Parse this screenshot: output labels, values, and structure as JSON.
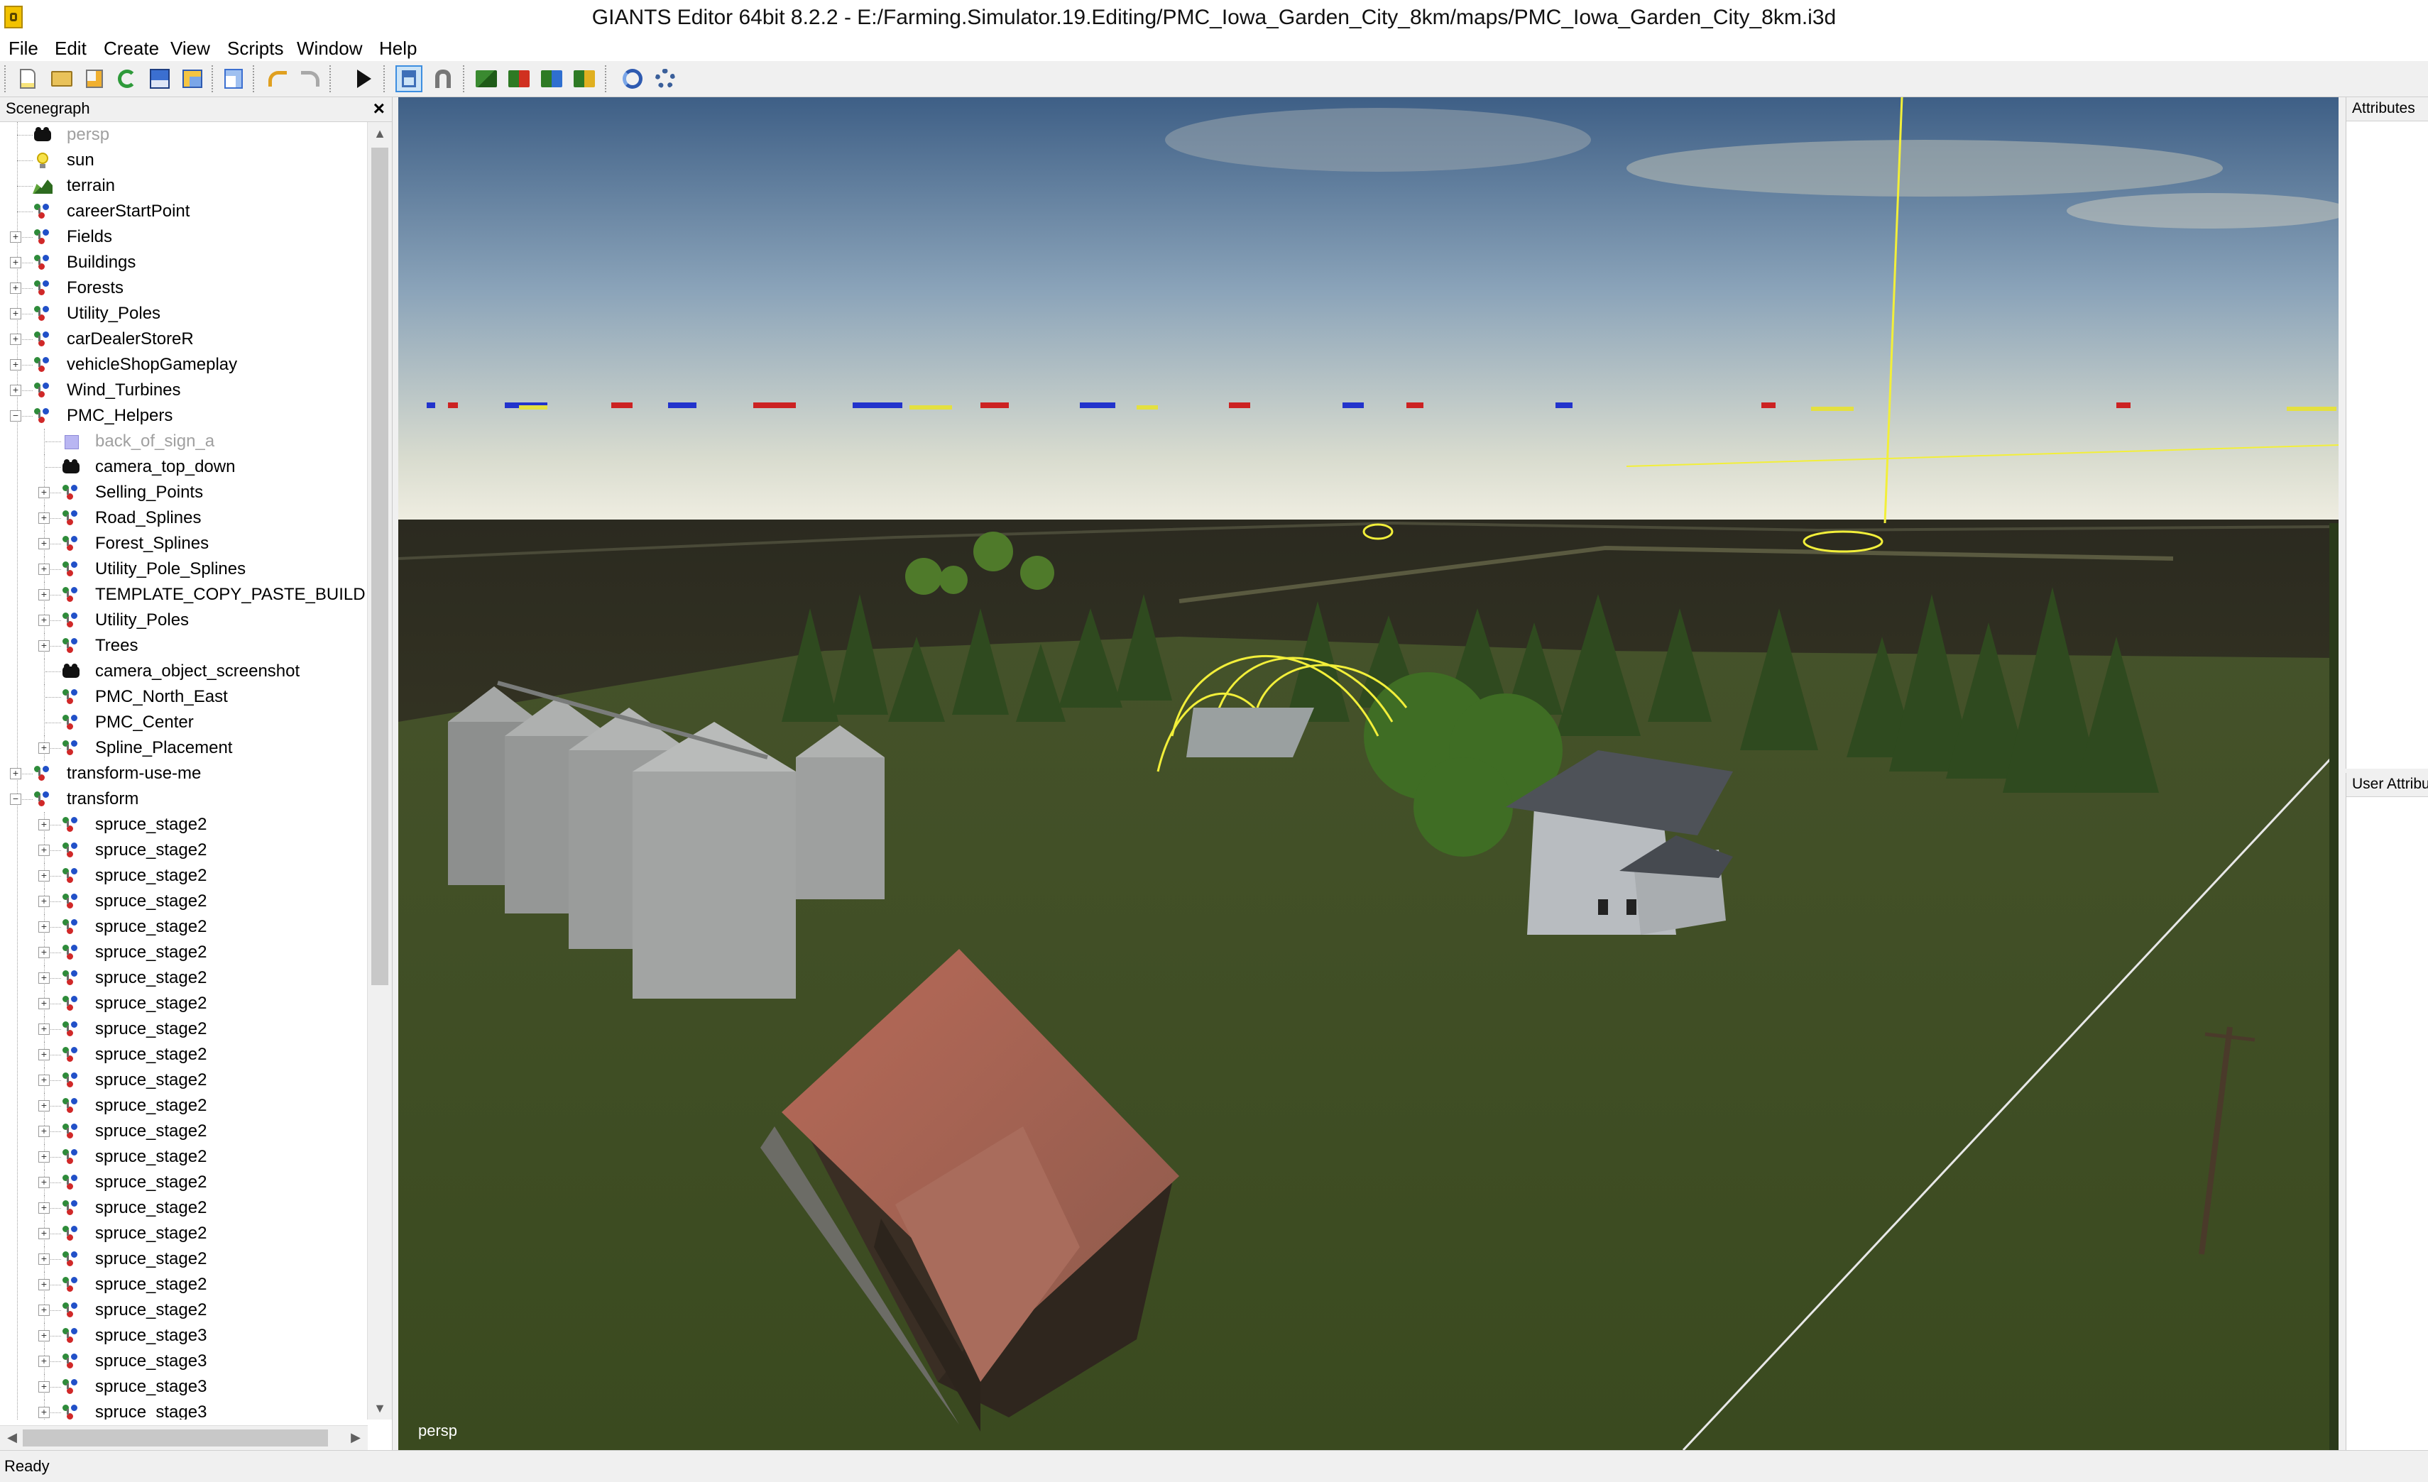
{
  "window": {
    "title": "GIANTS Editor 64bit 8.2.2 - E:/Farming.Simulator.19.Editing/PMC_Iowa_Garden_City_8km/maps/PMC_Iowa_Garden_City_8km.i3d"
  },
  "menu": {
    "items": [
      {
        "label": "File"
      },
      {
        "label": "Edit"
      },
      {
        "label": "Create"
      },
      {
        "label": "View"
      },
      {
        "label": "Scripts"
      },
      {
        "label": "Window"
      },
      {
        "label": "Help"
      }
    ]
  },
  "toolbar": {
    "buttons": [
      {
        "icon": "new-file-icon"
      },
      {
        "icon": "open-folder-icon"
      },
      {
        "icon": "edit-file-icon"
      },
      {
        "icon": "reload-icon"
      },
      {
        "icon": "save-icon"
      },
      {
        "icon": "export-icon"
      },
      {
        "icon": "import-icon"
      },
      {
        "icon": "undo-icon"
      },
      {
        "icon": "redo-icon"
      },
      {
        "icon": "play-icon"
      },
      {
        "icon": "select-mode-icon",
        "pressed": true
      },
      {
        "icon": "magnet-icon"
      },
      {
        "icon": "terrain-sculpt-icon"
      },
      {
        "icon": "terrain-paint-icon"
      },
      {
        "icon": "foliage-paint-icon"
      },
      {
        "icon": "object-placement-icon"
      },
      {
        "icon": "refresh-scene-icon"
      },
      {
        "icon": "settings-icon"
      }
    ]
  },
  "scenegraph": {
    "title": "Scenegraph",
    "close": "×",
    "items": [
      {
        "label": "persp",
        "icon": "camera-icon",
        "level": 0,
        "expander": "",
        "dim": true
      },
      {
        "label": "sun",
        "icon": "light-icon",
        "level": 0,
        "expander": ""
      },
      {
        "label": "terrain",
        "icon": "terrain-icon",
        "level": 0,
        "expander": ""
      },
      {
        "label": "careerStartPoint",
        "icon": "transform-group-icon",
        "level": 0,
        "expander": ""
      },
      {
        "label": "Fields",
        "icon": "transform-group-icon",
        "level": 0,
        "expander": "+"
      },
      {
        "label": "Buildings",
        "icon": "transform-group-icon",
        "level": 0,
        "expander": "+"
      },
      {
        "label": "Forests",
        "icon": "transform-group-icon",
        "level": 0,
        "expander": "+"
      },
      {
        "label": "Utility_Poles",
        "icon": "transform-group-icon",
        "level": 0,
        "expander": "+"
      },
      {
        "label": "carDealerStoreR",
        "icon": "transform-group-icon",
        "level": 0,
        "expander": "+"
      },
      {
        "label": "vehicleShopGameplay",
        "icon": "transform-group-icon",
        "level": 0,
        "expander": "+"
      },
      {
        "label": "Wind_Turbines",
        "icon": "transform-group-icon",
        "level": 0,
        "expander": "+"
      },
      {
        "label": "PMC_Helpers",
        "icon": "transform-group-icon",
        "level": 0,
        "expander": "−"
      },
      {
        "label": "back_of_sign_a",
        "icon": "shape-icon",
        "level": 1,
        "expander": "",
        "dim": true
      },
      {
        "label": "camera_top_down",
        "icon": "camera-icon",
        "level": 1,
        "expander": ""
      },
      {
        "label": "Selling_Points",
        "icon": "transform-group-icon",
        "level": 1,
        "expander": "+"
      },
      {
        "label": "Road_Splines",
        "icon": "transform-group-icon",
        "level": 1,
        "expander": "+"
      },
      {
        "label": "Forest_Splines",
        "icon": "transform-group-icon",
        "level": 1,
        "expander": "+"
      },
      {
        "label": "Utility_Pole_Splines",
        "icon": "transform-group-icon",
        "level": 1,
        "expander": "+"
      },
      {
        "label": "TEMPLATE_COPY_PASTE_BUILD",
        "icon": "transform-group-icon",
        "level": 1,
        "expander": "+"
      },
      {
        "label": "Utility_Poles",
        "icon": "transform-group-icon",
        "level": 1,
        "expander": "+"
      },
      {
        "label": "Trees",
        "icon": "transform-group-icon",
        "level": 1,
        "expander": "+"
      },
      {
        "label": "camera_object_screenshot",
        "icon": "camera-icon",
        "level": 1,
        "expander": ""
      },
      {
        "label": "PMC_North_East",
        "icon": "transform-group-icon",
        "level": 1,
        "expander": ""
      },
      {
        "label": "PMC_Center",
        "icon": "transform-group-icon",
        "level": 1,
        "expander": ""
      },
      {
        "label": "Spline_Placement",
        "icon": "transform-group-icon",
        "level": 1,
        "expander": "+"
      },
      {
        "label": "transform-use-me",
        "icon": "transform-group-icon",
        "level": 0,
        "expander": "+"
      },
      {
        "label": "transform",
        "icon": "transform-group-icon",
        "level": 0,
        "expander": "−"
      },
      {
        "label": "spruce_stage2",
        "icon": "transform-group-icon",
        "level": 1,
        "expander": "+"
      },
      {
        "label": "spruce_stage2",
        "icon": "transform-group-icon",
        "level": 1,
        "expander": "+"
      },
      {
        "label": "spruce_stage2",
        "icon": "transform-group-icon",
        "level": 1,
        "expander": "+"
      },
      {
        "label": "spruce_stage2",
        "icon": "transform-group-icon",
        "level": 1,
        "expander": "+"
      },
      {
        "label": "spruce_stage2",
        "icon": "transform-group-icon",
        "level": 1,
        "expander": "+"
      },
      {
        "label": "spruce_stage2",
        "icon": "transform-group-icon",
        "level": 1,
        "expander": "+"
      },
      {
        "label": "spruce_stage2",
        "icon": "transform-group-icon",
        "level": 1,
        "expander": "+"
      },
      {
        "label": "spruce_stage2",
        "icon": "transform-group-icon",
        "level": 1,
        "expander": "+"
      },
      {
        "label": "spruce_stage2",
        "icon": "transform-group-icon",
        "level": 1,
        "expander": "+"
      },
      {
        "label": "spruce_stage2",
        "icon": "transform-group-icon",
        "level": 1,
        "expander": "+"
      },
      {
        "label": "spruce_stage2",
        "icon": "transform-group-icon",
        "level": 1,
        "expander": "+"
      },
      {
        "label": "spruce_stage2",
        "icon": "transform-group-icon",
        "level": 1,
        "expander": "+"
      },
      {
        "label": "spruce_stage2",
        "icon": "transform-group-icon",
        "level": 1,
        "expander": "+"
      },
      {
        "label": "spruce_stage2",
        "icon": "transform-group-icon",
        "level": 1,
        "expander": "+"
      },
      {
        "label": "spruce_stage2",
        "icon": "transform-group-icon",
        "level": 1,
        "expander": "+"
      },
      {
        "label": "spruce_stage2",
        "icon": "transform-group-icon",
        "level": 1,
        "expander": "+"
      },
      {
        "label": "spruce_stage2",
        "icon": "transform-group-icon",
        "level": 1,
        "expander": "+"
      },
      {
        "label": "spruce_stage2",
        "icon": "transform-group-icon",
        "level": 1,
        "expander": "+"
      },
      {
        "label": "spruce_stage2",
        "icon": "transform-group-icon",
        "level": 1,
        "expander": "+"
      },
      {
        "label": "spruce_stage2",
        "icon": "transform-group-icon",
        "level": 1,
        "expander": "+"
      },
      {
        "label": "spruce_stage3",
        "icon": "transform-group-icon",
        "level": 1,
        "expander": "+"
      },
      {
        "label": "spruce_stage3",
        "icon": "transform-group-icon",
        "level": 1,
        "expander": "+"
      },
      {
        "label": "spruce_stage3",
        "icon": "transform-group-icon",
        "level": 1,
        "expander": "+"
      },
      {
        "label": "spruce_stage3",
        "icon": "transform-group-icon",
        "level": 1,
        "expander": "+"
      }
    ]
  },
  "viewport": {
    "camera_label": "persp"
  },
  "attributes": {
    "title": "Attributes"
  },
  "user_attributes": {
    "title": "User Attributes"
  },
  "status": {
    "text": "Ready"
  },
  "colors": {
    "selection": "#3d8ee0",
    "gizmo_yellow": "#f2ef3a",
    "grass": "#3b4a22"
  }
}
